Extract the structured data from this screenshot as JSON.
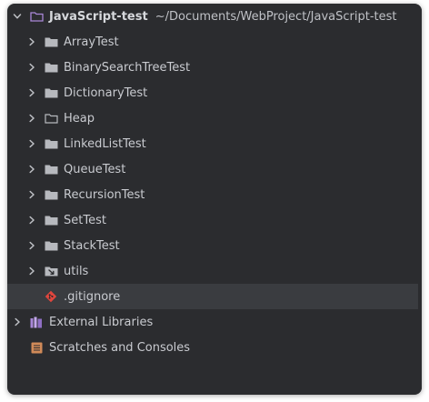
{
  "project": {
    "name": "JavaScript-test",
    "path": "~/Documents/WebProject/JavaScript-test"
  },
  "folders": [
    {
      "label": "ArrayTest"
    },
    {
      "label": "BinarySearchTreeTest"
    },
    {
      "label": "DictionaryTest"
    },
    {
      "label": "Heap"
    },
    {
      "label": "LinkedListTest"
    },
    {
      "label": "QueueTest"
    },
    {
      "label": "RecursionTest"
    },
    {
      "label": "SetTest"
    },
    {
      "label": "StackTest"
    },
    {
      "label": "utils"
    }
  ],
  "files": {
    "gitignore": ".gitignore"
  },
  "external_libraries": "External Libraries",
  "scratches": "Scratches and Consoles",
  "colors": {
    "background": "#2b2c2f",
    "selected_row": "#3a3c40",
    "text": "#c9cbd0",
    "folder_icon": "#b7b9be",
    "project_folder_icon": "#a987d8",
    "gitignore_icon": "#e0463d",
    "libraries_icon": "#a987d8",
    "scratches_icon": "#d08a58"
  },
  "icons": {
    "chevron_expanded": "chevron-down-icon",
    "chevron_collapsed": "chevron-right-icon",
    "folder": "folder-icon",
    "folder_outline": "folder-outline-icon",
    "folder_linked": "folder-linked-icon",
    "git_file": "git-file-icon",
    "libraries": "libraries-icon",
    "scratches": "scratches-icon"
  }
}
